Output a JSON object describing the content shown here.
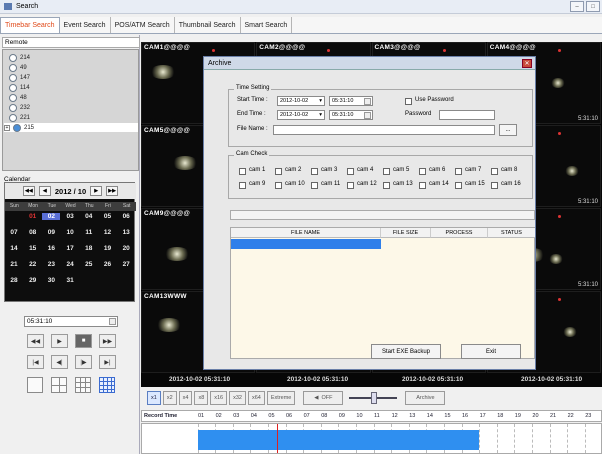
{
  "window": {
    "title": "Search"
  },
  "tabs": [
    "Timebar Search",
    "Event Search",
    "POS/ATM Search",
    "Thumbnail Search",
    "Smart Search"
  ],
  "remote": {
    "header": "Remote",
    "items": [
      "214",
      "49",
      "147",
      "114",
      "48",
      "232",
      "221",
      "215"
    ]
  },
  "calendar": {
    "label": "Calendar",
    "month": "2012 / 10",
    "weekdays": [
      "Sun",
      "Mon",
      "Tue",
      "Wed",
      "Thu",
      "Fri",
      "Sat"
    ],
    "weeks": [
      [
        "",
        "01",
        "02",
        "03",
        "04",
        "05",
        "06"
      ],
      [
        "07",
        "08",
        "09",
        "10",
        "11",
        "12",
        "13"
      ],
      [
        "14",
        "15",
        "16",
        "17",
        "18",
        "19",
        "20"
      ],
      [
        "21",
        "22",
        "23",
        "24",
        "25",
        "26",
        "27"
      ],
      [
        "28",
        "29",
        "30",
        "31",
        "",
        "",
        ""
      ]
    ],
    "selected_day": "02"
  },
  "time_value": "05:31:10",
  "cameras": [
    {
      "name": "CAM1@@@@",
      "ts": "2012-10-02"
    },
    {
      "name": "CAM2@@@@",
      "ts": ""
    },
    {
      "name": "CAM3@@@@",
      "ts": ""
    },
    {
      "name": "CAM4@@@@",
      "ts": "5:31:10"
    },
    {
      "name": "CAM5@@@@",
      "ts": "2012-10-02"
    },
    {
      "name": "",
      "ts": ""
    },
    {
      "name": "",
      "ts": ""
    },
    {
      "name": "",
      "ts": "5:31:10"
    },
    {
      "name": "CAM9@@@@",
      "ts": "2012-10-02"
    },
    {
      "name": "",
      "ts": ""
    },
    {
      "name": "",
      "ts": ""
    },
    {
      "name": "",
      "ts": "5:31:10"
    },
    {
      "name": "CAM13WWW",
      "ts": ""
    },
    {
      "name": "",
      "ts": ""
    },
    {
      "name": "",
      "ts": ""
    },
    {
      "name": "",
      "ts": ""
    }
  ],
  "date_row": [
    "2012-10-02 05:31:10",
    "2012-10-02 05:31:10",
    "2012-10-02 05:31:10",
    "2012-10-02 05:31:10"
  ],
  "timeline": {
    "zoom": [
      "x1",
      "x2",
      "x4",
      "x8",
      "x16",
      "x32",
      "x64",
      "Extreme"
    ],
    "audio": "OFF",
    "archive": "Archive",
    "header": "Record Time",
    "hours": [
      "01",
      "02",
      "03",
      "04",
      "05",
      "06",
      "07",
      "08",
      "09",
      "10",
      "11",
      "12",
      "13",
      "14",
      "15",
      "16",
      "17",
      "18",
      "19",
      "20",
      "21",
      "22",
      "23",
      "24"
    ],
    "record_from_hour": 1,
    "record_to_hour": 16,
    "cursor_hour": 5.5
  },
  "archive_dialog": {
    "title": "Archive",
    "time_setting": "Time Setting",
    "start_label": "Start Time :",
    "start_date": "2012-10-02",
    "start_time": "05:31:10",
    "end_label": "End Time :",
    "end_date": "2012-10-02",
    "end_time": "05:31:10",
    "use_password": "Use Password",
    "password_label": "Password",
    "file_name_label": "File Name :",
    "browse": "...",
    "cam_check": "Cam Check",
    "cams": [
      "cam 1",
      "cam 2",
      "cam 3",
      "cam 4",
      "cam 5",
      "cam 6",
      "cam 7",
      "cam 8",
      "cam 9",
      "cam 10",
      "cam 11",
      "cam 12",
      "cam 13",
      "cam 14",
      "cam 15",
      "cam 16"
    ],
    "columns": [
      "FILE NAME",
      "FILE SIZE",
      "PROCESS",
      "STATUS"
    ],
    "start_backup": "Start EXE Backup",
    "exit": "Exit"
  }
}
